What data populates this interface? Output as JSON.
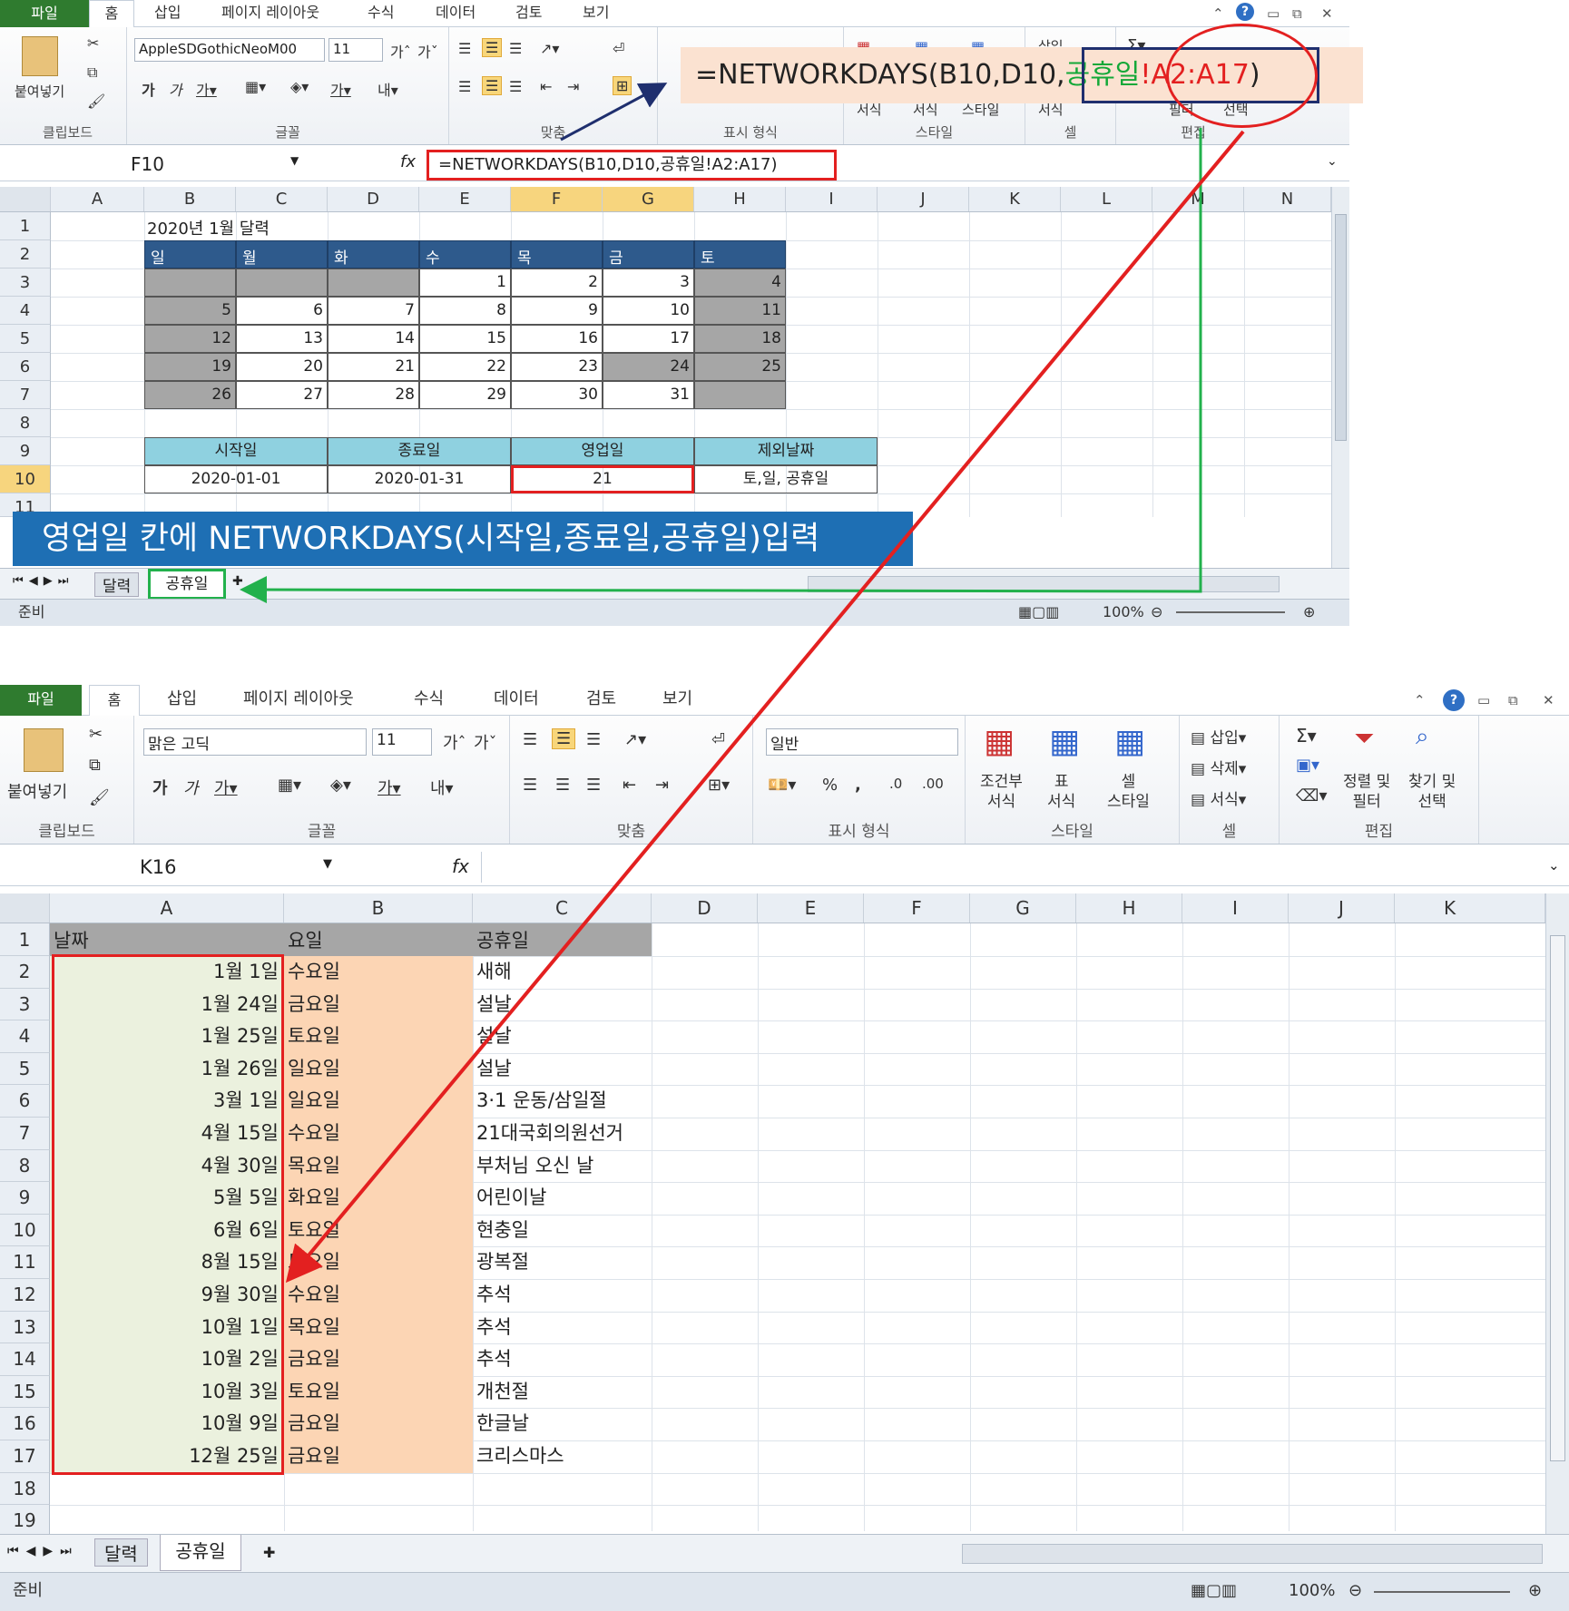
{
  "s1": {
    "tabs": [
      "파일",
      "홈",
      "삽입",
      "페이지 레이아웃",
      "수식",
      "데이터",
      "검토",
      "보기"
    ],
    "font_name": "AppleSDGothicNeoM00",
    "font_size": "11",
    "paste": "붙여넣기",
    "groups": [
      "클립보드",
      "글꼴",
      "맞춤",
      "표시 형식",
      "스타일",
      "셀",
      "편집"
    ],
    "style_labels": [
      "서식",
      "서식",
      "스타일"
    ],
    "cells_labels": [
      "삽입",
      "서식"
    ],
    "edit_labels": [
      "필터",
      "선택"
    ],
    "name_box": "F10",
    "formula": "=NETWORKDAYS(B10,D10,공휴일!A2:A17)",
    "columns": [
      "A",
      "B",
      "C",
      "D",
      "E",
      "F",
      "G",
      "H",
      "I",
      "J",
      "K",
      "L",
      "M",
      "N"
    ],
    "rows": [
      "1",
      "2",
      "3",
      "4",
      "5",
      "6",
      "7",
      "8",
      "9",
      "10",
      "11"
    ],
    "cal_title": "2020년 1월 달력",
    "weekdays": [
      "일",
      "월",
      "화",
      "수",
      "목",
      "금",
      "토"
    ],
    "weeks": [
      [
        "",
        "",
        "",
        "1",
        "2",
        "3",
        "4"
      ],
      [
        "5",
        "6",
        "7",
        "8",
        "9",
        "10",
        "11"
      ],
      [
        "12",
        "13",
        "14",
        "15",
        "16",
        "17",
        "18"
      ],
      [
        "19",
        "20",
        "21",
        "22",
        "23",
        "24",
        "25"
      ],
      [
        "26",
        "27",
        "28",
        "29",
        "30",
        "31",
        ""
      ]
    ],
    "summary_headers": [
      "시작일",
      "종료일",
      "영업일",
      "제외날짜"
    ],
    "summary_values": [
      "2020-01-01",
      "2020-01-31",
      "21",
      "토,일, 공휴일"
    ],
    "sheet_tabs": [
      "달력",
      "공휴일"
    ],
    "status": "준비",
    "zoom": "100%"
  },
  "callout": {
    "prefix": "=NETWORKDAYS(B10,D10,",
    "sheet": "공휴일",
    "range": "!A2:A17",
    "suffix": ")"
  },
  "banner": "영업일 칸에 NETWORKDAYS(시작일,종료일,공휴일)입력",
  "s2": {
    "tabs": [
      "파일",
      "홈",
      "삽입",
      "페이지 레이아웃",
      "수식",
      "데이터",
      "검토",
      "보기"
    ],
    "font_name": "맑은 고딕",
    "font_size": "11",
    "number_format": "일반",
    "paste": "붙여넣기",
    "groups": [
      "클립보드",
      "글꼴",
      "맞춤",
      "표시 형식",
      "스타일",
      "셀",
      "편집"
    ],
    "style_buttons": [
      [
        "조건부",
        "서식"
      ],
      [
        "표",
        "서식"
      ],
      [
        "셀",
        "스타일"
      ]
    ],
    "cells_buttons": [
      "삽입",
      "삭제",
      "서식"
    ],
    "edit_buttons": [
      [
        "정렬 및",
        "필터"
      ],
      [
        "찾기 및",
        "선택"
      ]
    ],
    "name_box": "K16",
    "formula": "",
    "columns": [
      "A",
      "B",
      "C",
      "D",
      "E",
      "F",
      "G",
      "H",
      "I",
      "J",
      "K"
    ],
    "rows": [
      "1",
      "2",
      "3",
      "4",
      "5",
      "6",
      "7",
      "8",
      "9",
      "10",
      "11",
      "12",
      "13",
      "14",
      "15",
      "16",
      "17",
      "18",
      "19"
    ],
    "headers": [
      "날짜",
      "요일",
      "공휴일"
    ],
    "holidays": [
      [
        "1월 1일",
        "수요일",
        "새해"
      ],
      [
        "1월 24일",
        "금요일",
        "설날"
      ],
      [
        "1월 25일",
        "토요일",
        "설날"
      ],
      [
        "1월 26일",
        "일요일",
        "설날"
      ],
      [
        "3월 1일",
        "일요일",
        "3·1 운동/삼일절"
      ],
      [
        "4월 15일",
        "수요일",
        "21대국회의원선거"
      ],
      [
        "4월 30일",
        "목요일",
        "부처님 오신 날"
      ],
      [
        "5월 5일",
        "화요일",
        "어린이날"
      ],
      [
        "6월 6일",
        "토요일",
        "현충일"
      ],
      [
        "8월 15일",
        "토요일",
        "광복절"
      ],
      [
        "9월 30일",
        "수요일",
        "추석"
      ],
      [
        "10월 1일",
        "목요일",
        "추석"
      ],
      [
        "10월 2일",
        "금요일",
        "추석"
      ],
      [
        "10월 3일",
        "토요일",
        "개천절"
      ],
      [
        "10월 9일",
        "금요일",
        "한글날"
      ],
      [
        "12월 25일",
        "금요일",
        "크리스마스"
      ]
    ],
    "sheet_tabs": [
      "달력",
      "공휴일"
    ],
    "status": "준비",
    "zoom": "100%"
  },
  "colors": {
    "header_blue": "#2e5a8c",
    "weekend_gray": "#a6a6a6",
    "summary_teal": "#8fd1e0",
    "date_green": "#ebf1de",
    "day_peach": "#fcd5b4",
    "holiday_gray": "#a6a6a6",
    "annotation_red": "#e32020",
    "annotation_green": "#22b14c",
    "banner_blue": "#1e6fb4"
  }
}
